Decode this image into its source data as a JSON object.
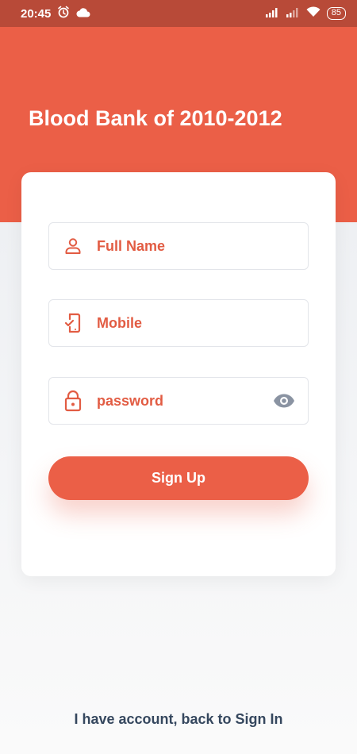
{
  "status_bar": {
    "time": "20:45",
    "battery": "85",
    "icons": [
      "alarm-icon",
      "cloud-icon",
      "signal-icon",
      "signal-icon",
      "wifi-icon",
      "battery-icon"
    ]
  },
  "header": {
    "title": "Blood Bank of 2010-2012",
    "color": "#eb5f47"
  },
  "form": {
    "full_name_placeholder": "Full Name",
    "mobile_placeholder": "Mobile",
    "password_placeholder": "password",
    "icons": {
      "full_name": "user-icon",
      "mobile": "mobile-check-icon",
      "password": "lock-icon",
      "toggle": "eye-icon"
    },
    "accent_color": "#e25c43",
    "signup_label": "Sign Up"
  },
  "footer": {
    "signin_link": "I have account, back to Sign In"
  }
}
